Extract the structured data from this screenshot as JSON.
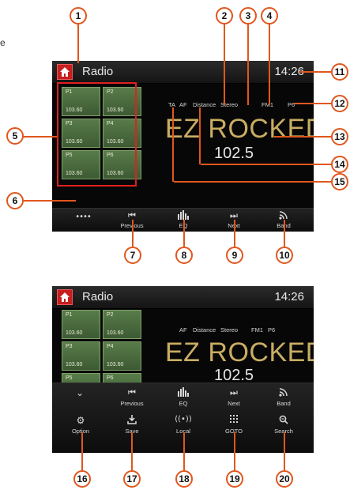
{
  "page_text": "e",
  "callouts": [
    "1",
    "2",
    "3",
    "4",
    "5",
    "6",
    "7",
    "8",
    "9",
    "10",
    "11",
    "12",
    "13",
    "14",
    "15",
    "16",
    "17",
    "18",
    "19",
    "20"
  ],
  "screen1": {
    "app_title": "Radio",
    "clock": "14:26",
    "presets": [
      {
        "name": "P1",
        "freq": "103.60"
      },
      {
        "name": "P2",
        "freq": "103.60"
      },
      {
        "name": "P3",
        "freq": "103.60"
      },
      {
        "name": "P4",
        "freq": "103.60"
      },
      {
        "name": "P5",
        "freq": "103.60"
      },
      {
        "name": "P6",
        "freq": "103.60"
      }
    ],
    "status": {
      "ta": "TA",
      "af": "AF",
      "distance": "Distance",
      "stereo": "Stereo",
      "band": "FM1",
      "preset": "P6"
    },
    "station": "EZ ROCKED",
    "frequency": "102.5",
    "buttons": {
      "more_icon": "••••",
      "previous": "Previous",
      "eq": "EQ",
      "next": "Next",
      "band": "Band"
    }
  },
  "screen2": {
    "app_title": "Radio",
    "clock": "14:26",
    "presets": [
      {
        "name": "P1",
        "freq": "103.60"
      },
      {
        "name": "P2",
        "freq": "103.60"
      },
      {
        "name": "P3",
        "freq": "103.60"
      },
      {
        "name": "P4",
        "freq": "103.60"
      },
      {
        "name": "P5",
        "freq": ""
      },
      {
        "name": "P6",
        "freq": ""
      }
    ],
    "status": {
      "af": "AF",
      "distance": "Distance",
      "stereo": "Stereo",
      "band": "FM1",
      "preset": "P6"
    },
    "station": "EZ ROCKED",
    "frequency": "102.5",
    "buttons_row1": {
      "previous": "Previous",
      "eq": "EQ",
      "next": "Next",
      "band": "Band"
    },
    "buttons_row2": {
      "option": "Option",
      "save": "Save",
      "local": "Local",
      "goto": "GOTO",
      "search": "Search"
    }
  },
  "icons": {
    "home": "home-icon",
    "more": "more-dots-icon",
    "previous": "skip-previous-icon",
    "eq": "equalizer-icon",
    "next": "skip-next-icon",
    "band": "band-signal-icon",
    "collapse": "chevron-down-icon",
    "option": "gear-icon",
    "save": "download-icon",
    "local": "local-signal-icon",
    "goto": "keypad-icon",
    "search": "search-icon"
  },
  "colors": {
    "accent": "#e0571e",
    "highlight_box": "#e02020",
    "station_text": "#c9ad63",
    "preset_green": "#4a6b3d"
  }
}
